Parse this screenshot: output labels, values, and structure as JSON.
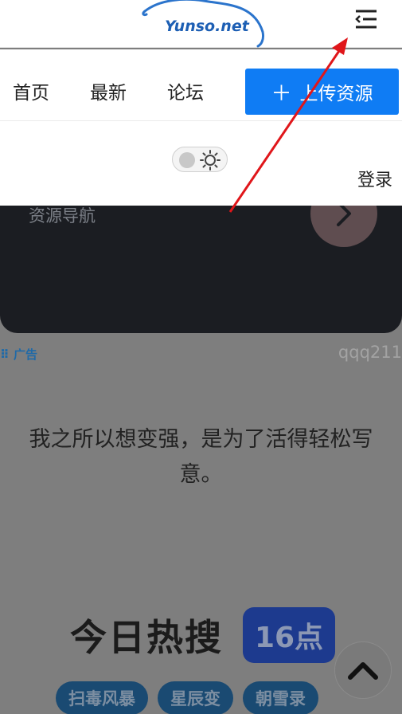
{
  "header": {
    "logo_text": "Yunso.net",
    "menu_icon": "menu-collapse-icon"
  },
  "menu": {
    "items": [
      {
        "label": "首页"
      },
      {
        "label": "最新"
      },
      {
        "label": "论坛"
      }
    ],
    "upload_label": "上传资源",
    "upload_icon": "plus-icon",
    "login_label": "登录",
    "theme_icon": "sun-icon"
  },
  "background": {
    "nav_card_title": "资源导航",
    "ad_label": "广告",
    "ad_user": "qqq211",
    "quote": "我之所以想变强，是为了活得轻松写意。",
    "hot_title": "今日热搜",
    "hot_time": "16点",
    "tags": [
      "扫毒风暴",
      "星辰变",
      "朝雪录"
    ]
  },
  "colors": {
    "accent": "#0f7cf4",
    "annotation": "#e0161a",
    "overlay": "#7e7e7e"
  }
}
